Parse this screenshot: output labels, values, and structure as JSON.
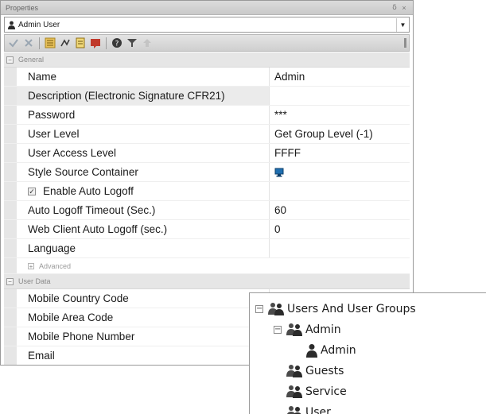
{
  "window": {
    "title": "Properties",
    "pin_glyph": "ẟ",
    "close_glyph": "×"
  },
  "selector": {
    "value": "Admin User"
  },
  "categories": {
    "general": "General",
    "advanced": "Advanced",
    "user_data": "User Data"
  },
  "properties": [
    {
      "name": "Name",
      "value": "Admin"
    },
    {
      "name": "Description (Electronic Signature CFR21)",
      "value": ""
    },
    {
      "name": "Password",
      "value": "***"
    },
    {
      "name": "User Level",
      "value": "Get Group Level (-1)"
    },
    {
      "name": "User Access Level",
      "value": "FFFF"
    },
    {
      "name": "Style Source Container",
      "value": "",
      "icon": "monitor-icon"
    },
    {
      "name": "Enable Auto Logoff",
      "value": "",
      "checked": true
    },
    {
      "name": "Auto Logoff Timeout (Sec.)",
      "value": "60"
    },
    {
      "name": "Web Client Auto Logoff (sec.)",
      "value": "0"
    },
    {
      "name": "Language",
      "value": ""
    }
  ],
  "user_data": [
    {
      "name": "Mobile Country Code",
      "value": ""
    },
    {
      "name": "Mobile Area Code",
      "value": ""
    },
    {
      "name": "Mobile Phone Number",
      "value": ""
    },
    {
      "name": "Email",
      "value": ""
    }
  ],
  "tree": {
    "root": "Users And User Groups",
    "admin_group": "Admin",
    "admin_user": "Admin",
    "guests": "Guests",
    "service": "Service",
    "user": "User"
  },
  "colors": {
    "toolbar_bg": "#d6d6d6",
    "category_bg": "#e6e6e6",
    "monitor_icon": "#1f6fb0",
    "favorite_icon": "#c0392b"
  }
}
